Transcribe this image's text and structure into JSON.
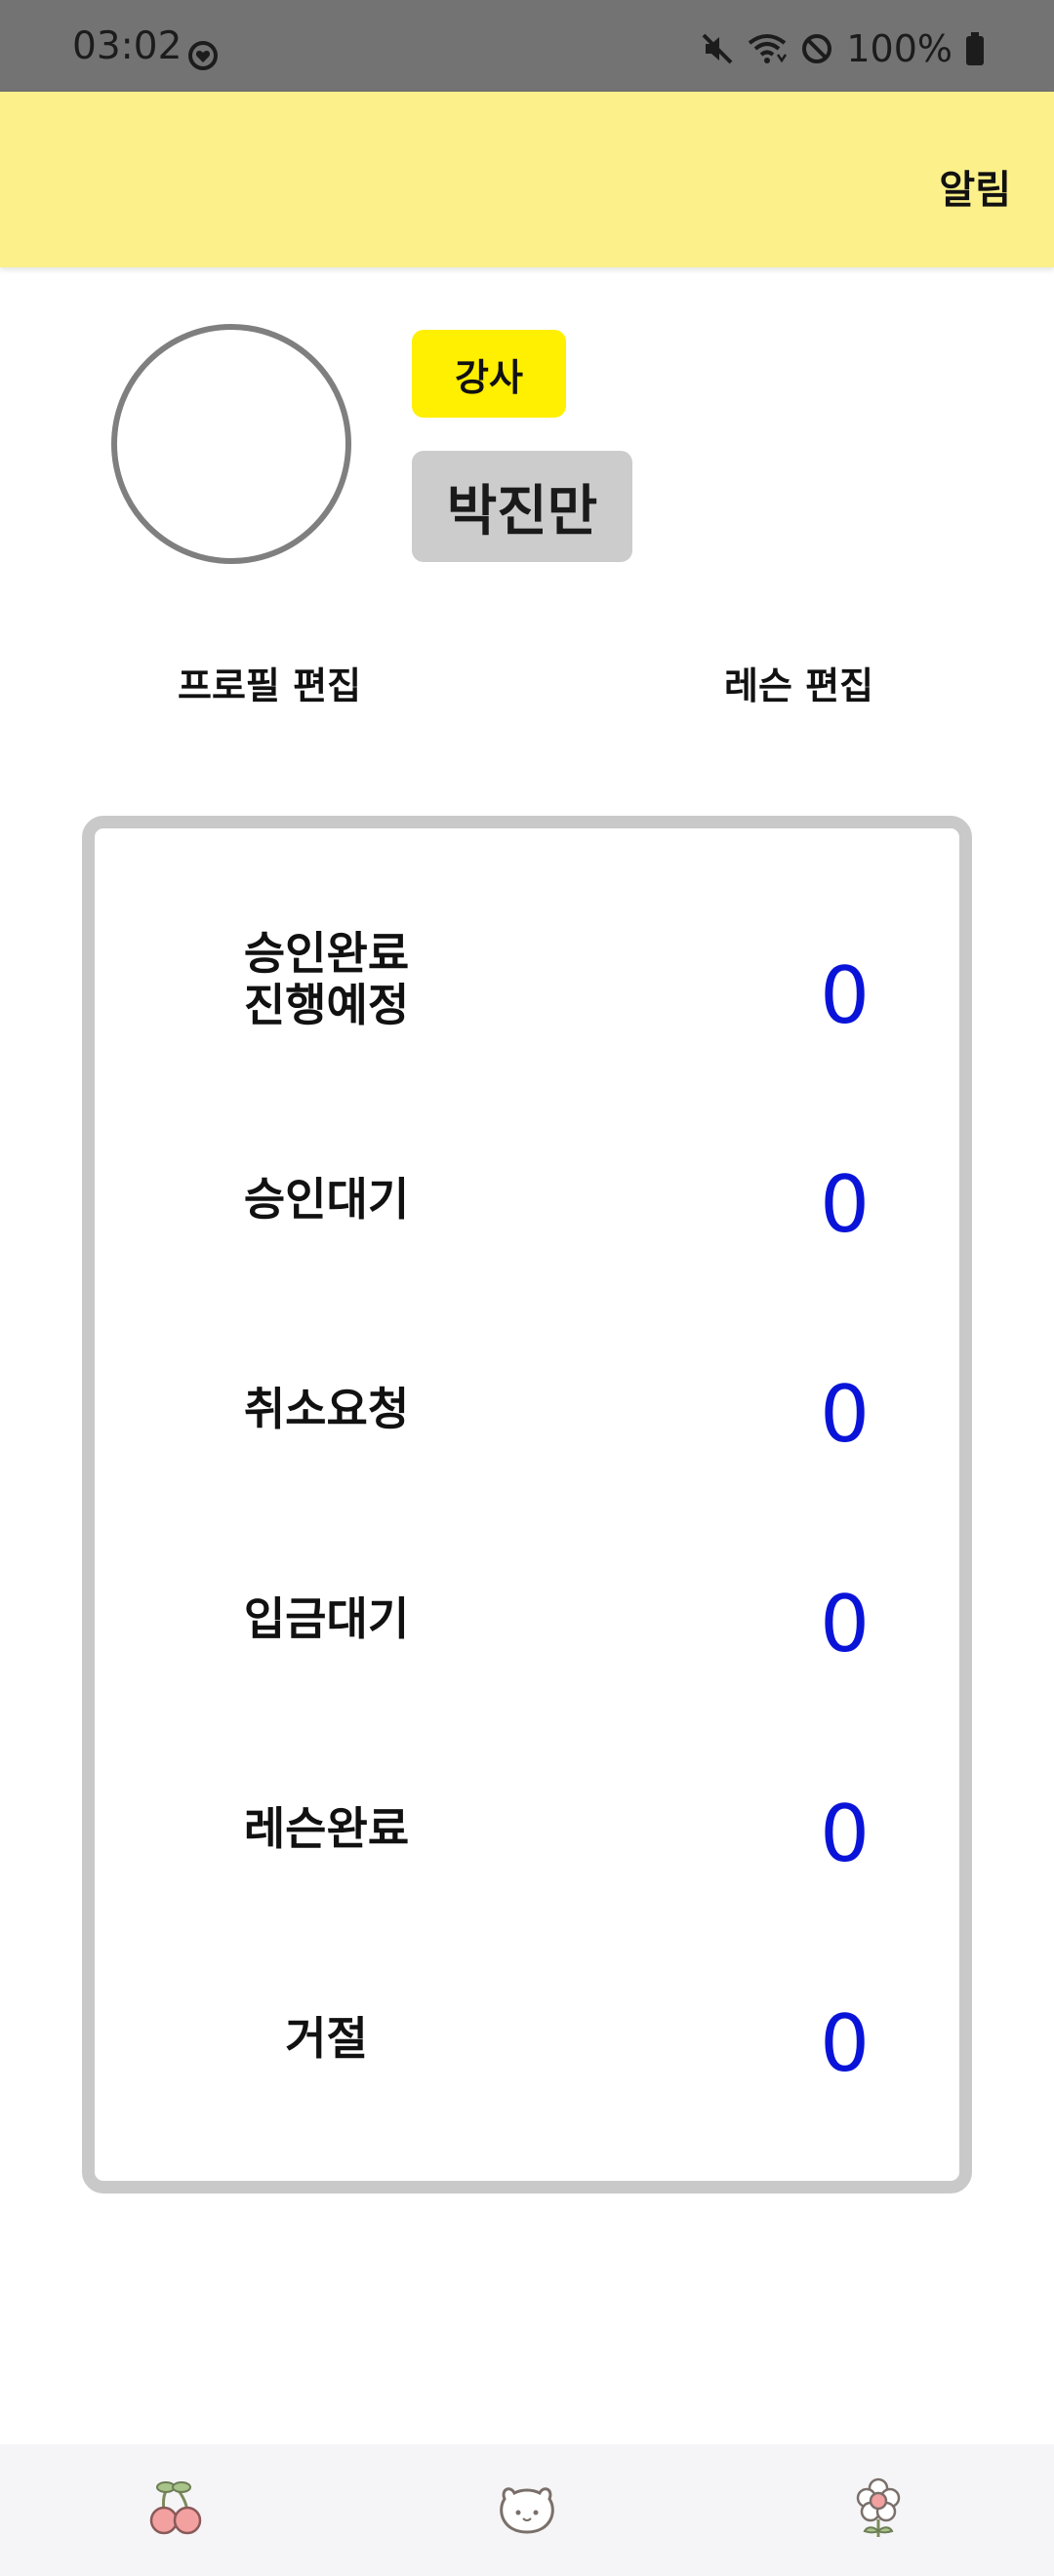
{
  "status_bar": {
    "time": "03:02",
    "battery": "100%"
  },
  "app_bar": {
    "notifications_label": "알림"
  },
  "profile": {
    "role": "강사",
    "name": "박진만",
    "edit_profile_label": "프로필 편집",
    "edit_lesson_label": "레슨 편집"
  },
  "stats": [
    {
      "label": "승인완료\n진행예정",
      "line1": "승인완료",
      "line2": "진행예정",
      "value": "0"
    },
    {
      "label": "승인대기",
      "value": "0"
    },
    {
      "label": "취소요청",
      "value": "0"
    },
    {
      "label": "입금대기",
      "value": "0"
    },
    {
      "label": "레슨완료",
      "value": "0"
    },
    {
      "label": "거절",
      "value": "0"
    }
  ],
  "bottom_nav": {
    "items": [
      "cherry-icon",
      "bear-face-icon",
      "flower-icon"
    ]
  },
  "colors": {
    "status_bar": "#737373",
    "app_bar": "#fbf089",
    "role_badge": "#ffef00",
    "name_box": "#cccccc",
    "stat_value": "#0a14d8",
    "card_border": "#c9c9c9"
  }
}
